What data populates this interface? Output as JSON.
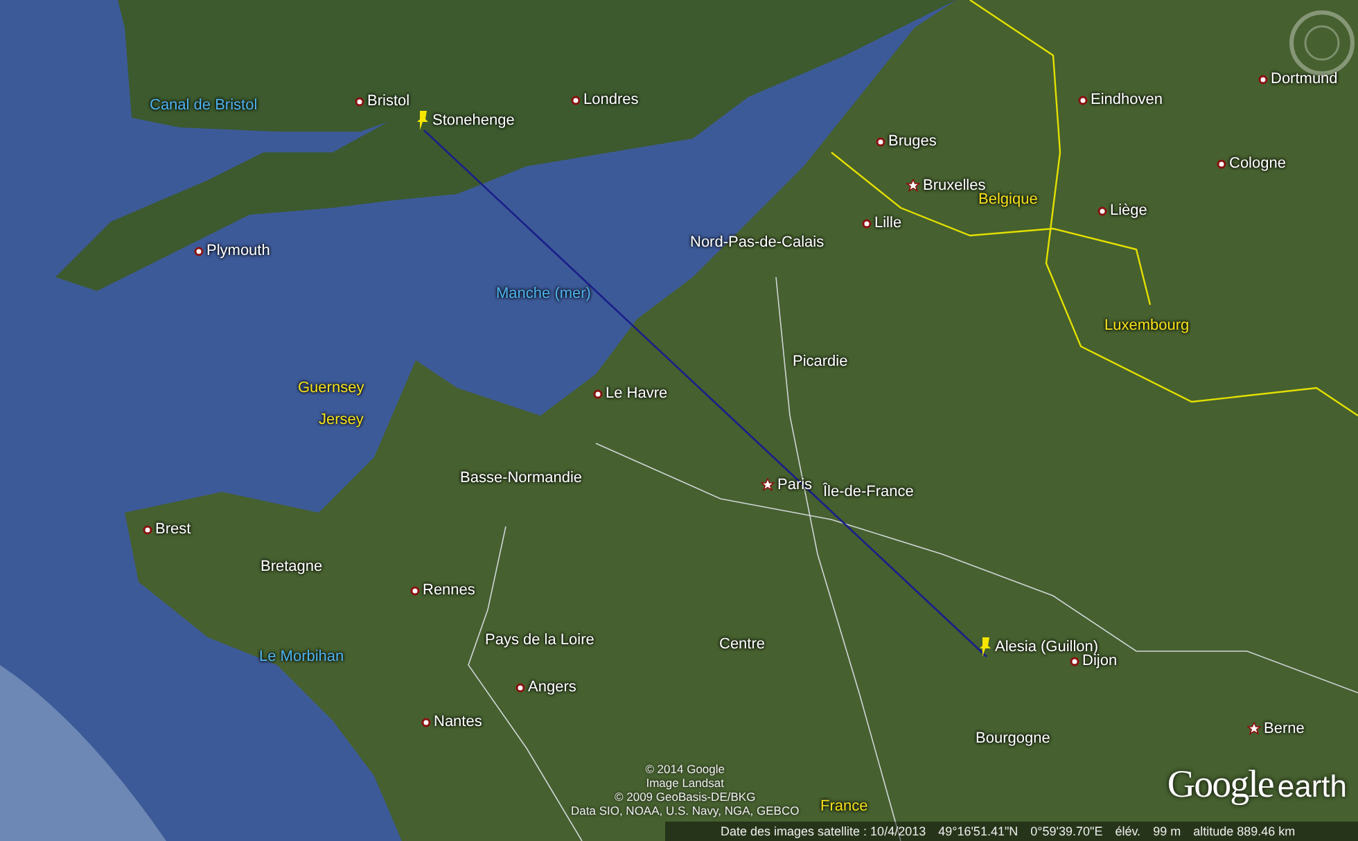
{
  "map": {
    "labels": [
      {
        "text": "Canal de Bristol",
        "kind": "sea"
      },
      {
        "text": "Bristol",
        "kind": "city"
      },
      {
        "text": "Stonehenge",
        "kind": "placemark"
      },
      {
        "text": "Londres",
        "kind": "city"
      },
      {
        "text": "Plymouth",
        "kind": "city"
      },
      {
        "text": "Manche (mer)",
        "kind": "sea"
      },
      {
        "text": "Eindhoven",
        "kind": "city"
      },
      {
        "text": "Dortmund",
        "kind": "city"
      },
      {
        "text": "Bruges",
        "kind": "city"
      },
      {
        "text": "Bruxelles",
        "kind": "capital"
      },
      {
        "text": "Belgique",
        "kind": "country"
      },
      {
        "text": "Cologne",
        "kind": "city"
      },
      {
        "text": "Lille",
        "kind": "city"
      },
      {
        "text": "Nord-Pas-de-Calais",
        "kind": "region"
      },
      {
        "text": "Liège",
        "kind": "city"
      },
      {
        "text": "Luxembourg",
        "kind": "country"
      },
      {
        "text": "Picardie",
        "kind": "region"
      },
      {
        "text": "Guernsey",
        "kind": "country"
      },
      {
        "text": "Jersey",
        "kind": "country"
      },
      {
        "text": "Le Havre",
        "kind": "city"
      },
      {
        "text": "Basse-Normandie",
        "kind": "region"
      },
      {
        "text": "Paris",
        "kind": "capital"
      },
      {
        "text": "Île-de-France",
        "kind": "region"
      },
      {
        "text": "Brest",
        "kind": "city"
      },
      {
        "text": "Bretagne",
        "kind": "region"
      },
      {
        "text": "Rennes",
        "kind": "city"
      },
      {
        "text": "Pays de la Loire",
        "kind": "region"
      },
      {
        "text": "Centre",
        "kind": "region"
      },
      {
        "text": "Le Morbihan",
        "kind": "sea"
      },
      {
        "text": "Alesia (Guillon)",
        "kind": "placemark"
      },
      {
        "text": "Dijon",
        "kind": "city"
      },
      {
        "text": "Angers",
        "kind": "city"
      },
      {
        "text": "Nantes",
        "kind": "city"
      },
      {
        "text": "Bourgogne",
        "kind": "region"
      },
      {
        "text": "Berne",
        "kind": "capital"
      },
      {
        "text": "France",
        "kind": "country"
      }
    ],
    "attribution": [
      "© 2014 Google",
      "Image Landsat",
      "© 2009 GeoBasis-DE/BKG",
      "Data SIO, NOAA, U.S. Navy, NGA, GEBCO"
    ]
  },
  "logo": {
    "brand": "Google",
    "product": "earth"
  },
  "status_bar": {
    "imagery_date": "Date des images satellite : 10/4/2013",
    "latitude": "49°16'51.41\"N",
    "longitude": "0°59'39.70\"E",
    "elevation_label": "élév.",
    "elevation": "99 m",
    "altitude": "altitude 889.46 km"
  }
}
